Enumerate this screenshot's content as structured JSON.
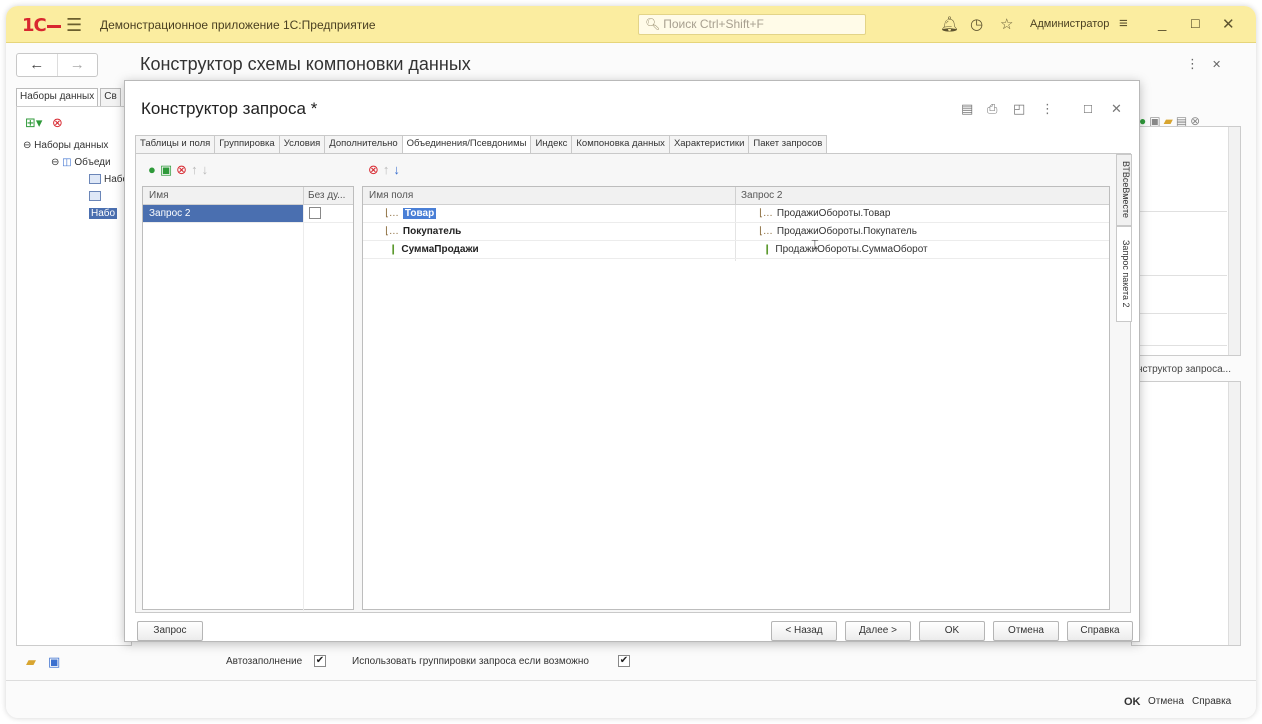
{
  "titlebar": {
    "logo": "1С",
    "app_title": "Демонстрационное приложение 1С:Предприятие",
    "search_placeholder": "Поиск Ctrl+Shift+F",
    "user": "Администратор"
  },
  "form": {
    "title": "Конструктор схемы компоновки данных",
    "tabs": [
      "Наборы данных",
      "Св"
    ],
    "tree": {
      "root": "Наборы данных",
      "child": "Объеди",
      "items": [
        "Набо",
        "Набо"
      ]
    },
    "right_label": "нструктор запроса...",
    "autofill_label": "Автозаполнение",
    "use_groupings_label": "Использовать группировки запроса если возможно"
  },
  "dialog": {
    "title": "Конструктор запроса *",
    "tabs": [
      "Таблицы и поля",
      "Группировка",
      "Условия",
      "Дополнительно",
      "Объединения/Псевдонимы",
      "Индекс",
      "Компоновка данных",
      "Характеристики",
      "Пакет запросов"
    ],
    "active_tab": "Объединения/Псевдонимы",
    "left_grid": {
      "columns": [
        "Имя",
        "Без ду..."
      ],
      "rows": [
        {
          "name": "Запрос 2",
          "no_dup": false
        }
      ]
    },
    "right_grid": {
      "columns": [
        "Имя поля",
        "Запрос 2"
      ],
      "rows": [
        {
          "field": "Товар",
          "source": "ПродажиОбороты.Товар",
          "icon": "dimension-icon"
        },
        {
          "field": "Покупатель",
          "source": "ПродажиОбороты.Покупатель",
          "icon": "dimension-icon"
        },
        {
          "field": "СуммаПродажи",
          "source": "ПродажиОбороты.СуммаОборот",
          "icon": "resource-icon"
        }
      ]
    },
    "vertical_tabs": [
      "ВТВсеВместе",
      "Запрос пакета 2"
    ],
    "buttons": {
      "query": "Запрос",
      "back": "< Назад",
      "next": "Далее >",
      "ok": "OK",
      "cancel": "Отмена",
      "help": "Справка"
    }
  },
  "statusbar": {
    "ok": "OK",
    "cancel": "Отмена",
    "help": "Справка"
  }
}
